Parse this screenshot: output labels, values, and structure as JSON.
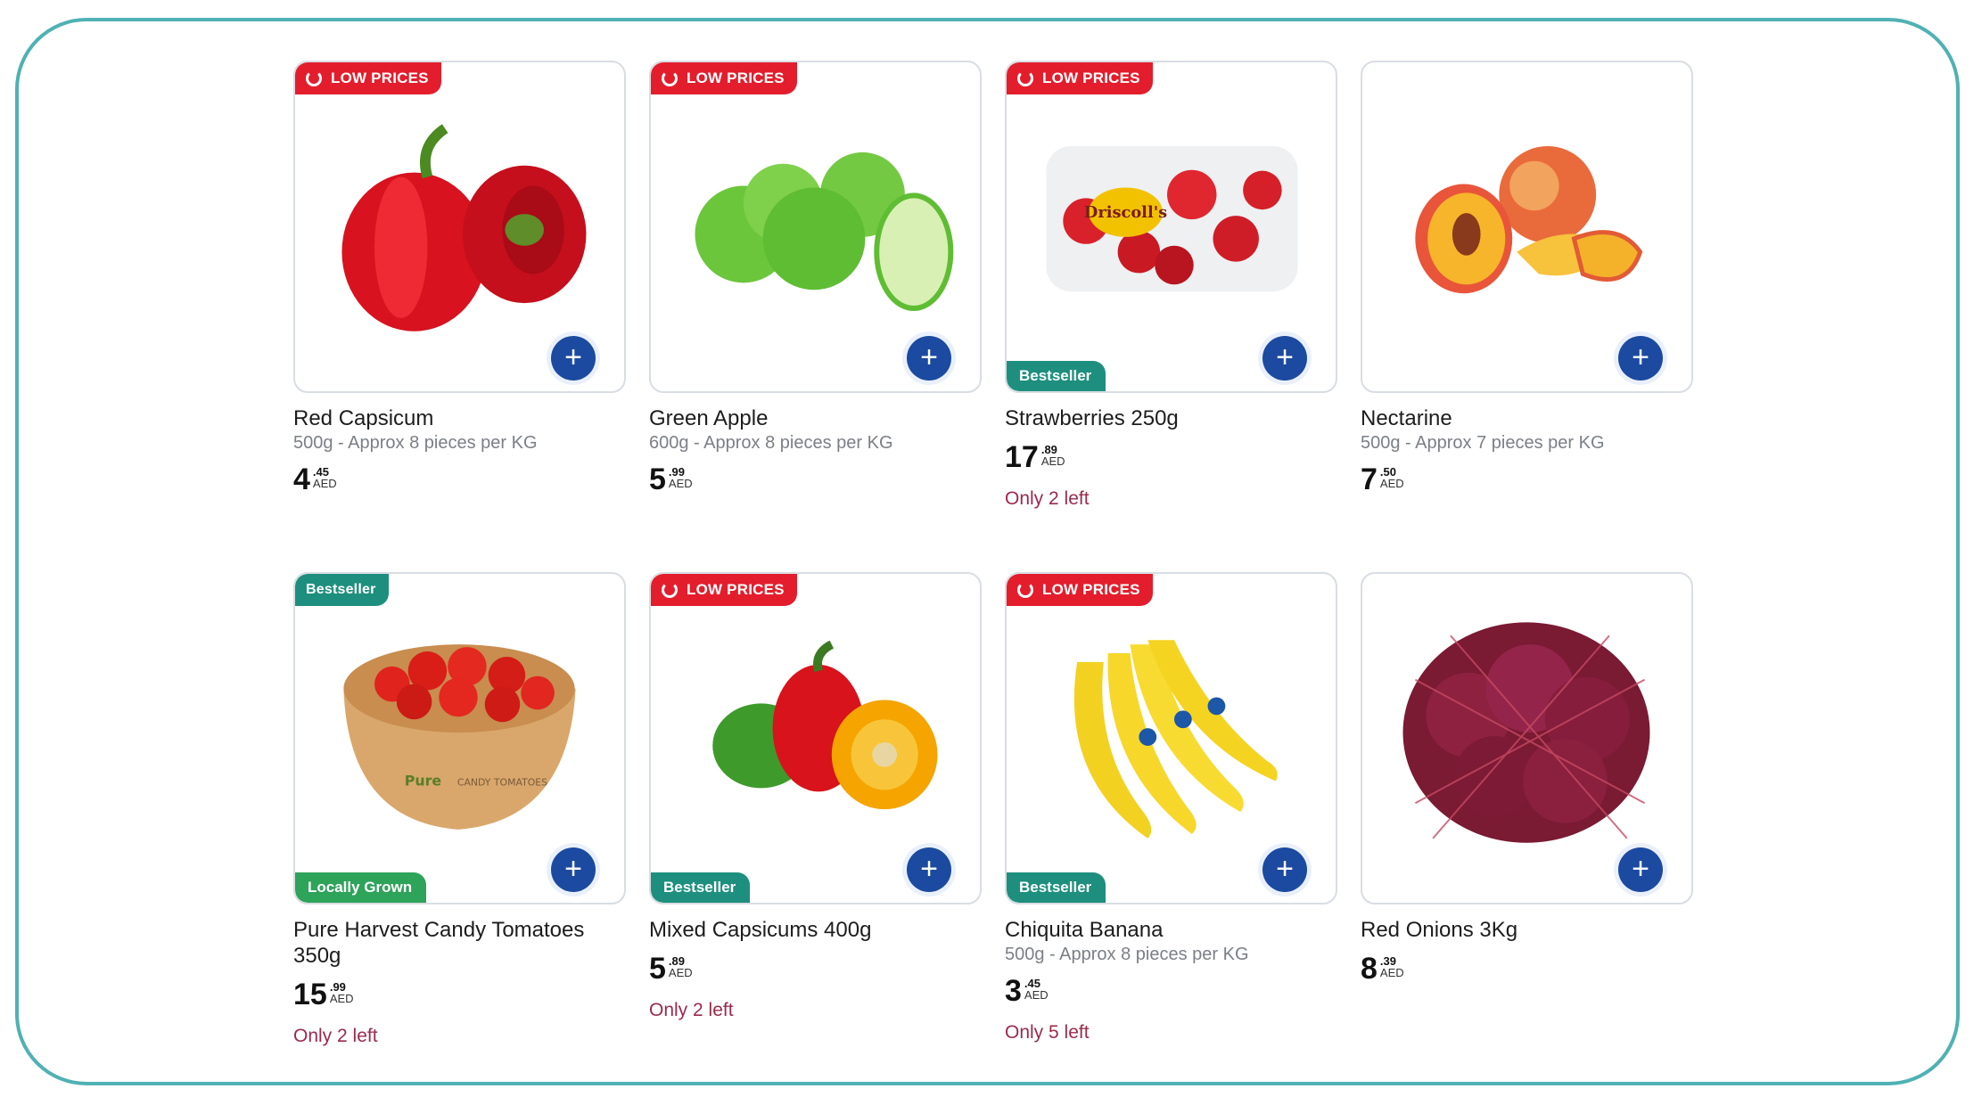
{
  "products": [
    {
      "name": "Red Capsicum",
      "sub": "500g - Approx 8 pieces per KG",
      "price_int": "4",
      "price_dec": ".45",
      "currency": "AED",
      "top_badge": "LOW PRICES",
      "bottom_badge": "",
      "stock": "",
      "image": "red-capsicum-image"
    },
    {
      "name": "Green Apple",
      "sub": "600g - Approx 8 pieces per KG",
      "price_int": "5",
      "price_dec": ".99",
      "currency": "AED",
      "top_badge": "LOW PRICES",
      "bottom_badge": "",
      "stock": "",
      "image": "green-apple-image"
    },
    {
      "name": "Strawberries 250g",
      "sub": "",
      "price_int": "17",
      "price_dec": ".89",
      "currency": "AED",
      "top_badge": "LOW PRICES",
      "bottom_badge": "Bestseller",
      "stock": "Only 2 left",
      "image": "strawberries-image"
    },
    {
      "name": "Nectarine",
      "sub": "500g - Approx 7 pieces per KG",
      "price_int": "7",
      "price_dec": ".50",
      "currency": "AED",
      "top_badge": "",
      "bottom_badge": "",
      "stock": "",
      "image": "nectarine-image"
    },
    {
      "name": "Pure Harvest Candy Tomatoes 350g",
      "sub": "",
      "price_int": "15",
      "price_dec": ".99",
      "currency": "AED",
      "top_badge": "Bestseller",
      "bottom_badge": "Locally Grown",
      "stock": "Only 2 left",
      "image": "candy-tomatoes-image"
    },
    {
      "name": "Mixed Capsicums 400g",
      "sub": "",
      "price_int": "5",
      "price_dec": ".89",
      "currency": "AED",
      "top_badge": "LOW PRICES",
      "bottom_badge": "Bestseller",
      "stock": "Only 2 left",
      "image": "mixed-capsicums-image"
    },
    {
      "name": "Chiquita Banana",
      "sub": "500g - Approx 8 pieces per KG",
      "price_int": "3",
      "price_dec": ".45",
      "currency": "AED",
      "top_badge": "LOW PRICES",
      "bottom_badge": "Bestseller",
      "stock": "Only 5 left",
      "image": "banana-image"
    },
    {
      "name": "Red Onions 3Kg",
      "sub": "",
      "price_int": "8",
      "price_dec": ".39",
      "currency": "AED",
      "top_badge": "",
      "bottom_badge": "",
      "stock": "",
      "image": "red-onions-image"
    }
  ],
  "add_label": "+",
  "product_labels": {
    "driscolls": "Driscoll's",
    "pure": "Pure",
    "candy_tomatoes": "CANDY TOMATOES"
  },
  "colors": {
    "frame": "#4fb1b3",
    "low_prices": "#e31d2c",
    "bestseller": "#1e8f7e",
    "locally_grown": "#2ea35a",
    "add_button": "#1b4aa0",
    "stock": "#9b2a4b"
  }
}
